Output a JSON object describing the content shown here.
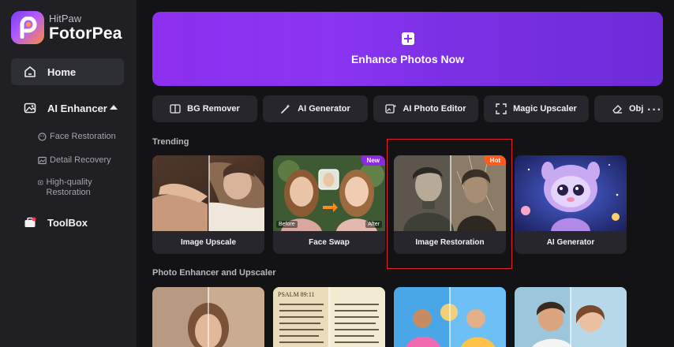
{
  "app": {
    "brand_small": "HitPaw",
    "brand_big": "FotorPea"
  },
  "sidebar": {
    "home": "Home",
    "ai_enhancer": "AI Enhancer",
    "sub_items": [
      "Face Restoration",
      "Detail Recovery",
      "High-quality Restoration"
    ],
    "toolbox": "ToolBox"
  },
  "hero": {
    "label": "Enhance Photos Now"
  },
  "tools": [
    "BG Remover",
    "AI Generator",
    "AI Photo Editor",
    "Magic Upscaler",
    "Obj"
  ],
  "more_label": "···",
  "trending": {
    "title": "Trending",
    "cards": [
      {
        "label": "Image Upscale"
      },
      {
        "label": "Face Swap",
        "badge": "New",
        "before": "Before",
        "after": "After"
      },
      {
        "label": "Image Restoration",
        "badge": "Hot"
      },
      {
        "label": "AI Generator"
      }
    ]
  },
  "photo_enhancer": {
    "title": "Photo Enhancer and Upscaler",
    "book_text": "PSALM 89:11"
  },
  "colors": {
    "accent": "#8a35f2",
    "badge_new": "#8a2be2",
    "badge_hot": "#ff5a1f",
    "highlight": "#e0202a"
  }
}
